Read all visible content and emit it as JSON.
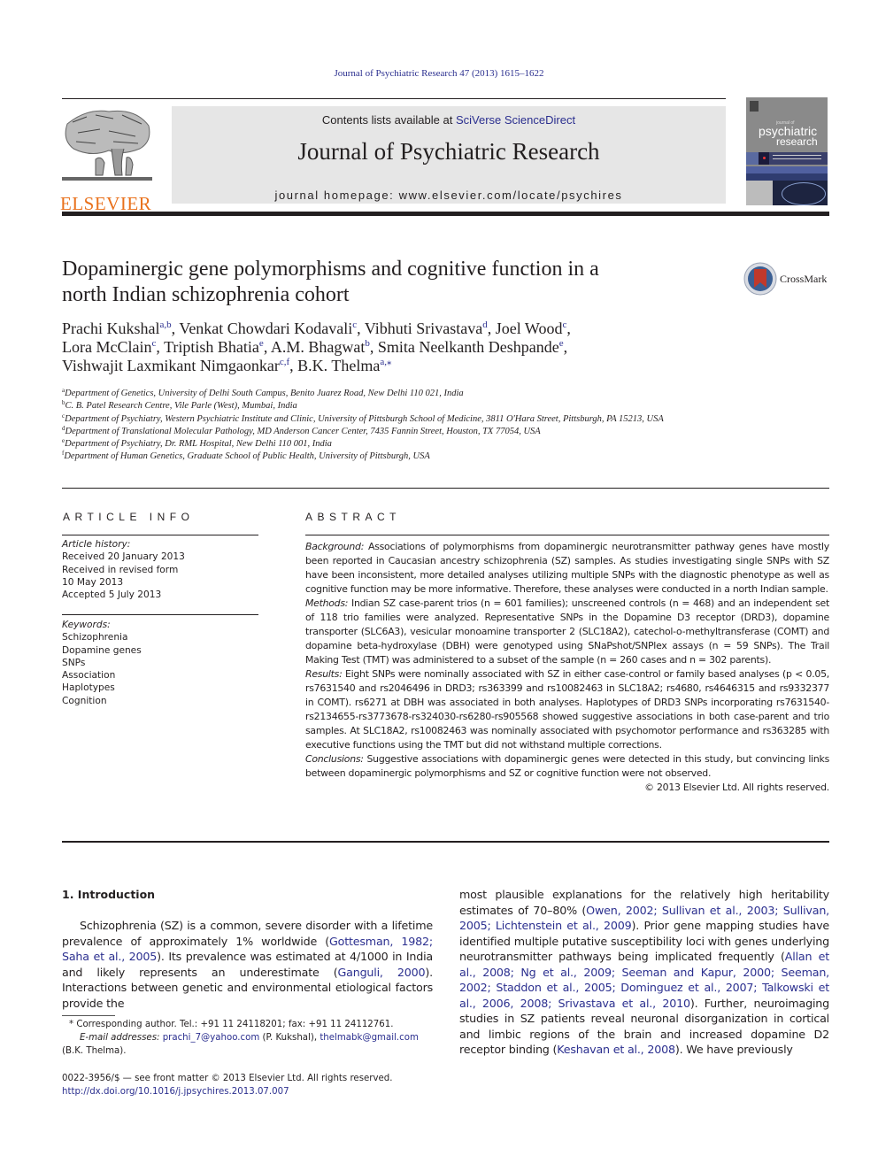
{
  "header": {
    "citation": "Journal of Psychiatric Research 47 (2013) 1615–1622",
    "contents_prefix": "Contents lists available at ",
    "contents_link": "SciVerse ScienceDirect",
    "journal_title": "Journal of Psychiatric Research",
    "homepage_prefix": "journal homepage: ",
    "homepage_url": "www.elsevier.com/locate/psychires",
    "publisher_logo_text": "ELSEVIER",
    "cover_small": "journal of",
    "cover_title_1": "psychiatric",
    "cover_title_2": "research",
    "crossmark_label": "CrossMark"
  },
  "colors": {
    "link": "#2b2f8f",
    "elsevier_orange": "#e9711c",
    "banner_gray": "#e6e6e6",
    "crossmark_red": "#c0392b"
  },
  "article": {
    "title_line1": "Dopaminergic gene polymorphisms and cognitive function in a",
    "title_line2": "north Indian schizophrenia cohort",
    "authors": [
      {
        "name": "Prachi Kukshal",
        "sup": "a,b",
        "sep": ", "
      },
      {
        "name": "Venkat Chowdari Kodavali",
        "sup": "c",
        "sep": ", "
      },
      {
        "name": "Vibhuti Srivastava",
        "sup": "d",
        "sep": ", "
      },
      {
        "name": "Joel Wood",
        "sup": "c",
        "sep": ","
      },
      {
        "name": "Lora McClain",
        "sup": "c",
        "sep": ", "
      },
      {
        "name": "Triptish Bhatia",
        "sup": "e",
        "sep": ", "
      },
      {
        "name": "A.M. Bhagwat",
        "sup": "b",
        "sep": ", "
      },
      {
        "name": "Smita Neelkanth Deshpande",
        "sup": "e",
        "sep": ","
      },
      {
        "name": "Vishwajit Laxmikant Nimgaonkar",
        "sup": "c,f",
        "sep": ", "
      },
      {
        "name": "B.K. Thelma",
        "sup": "a,⁎",
        "sep": ""
      }
    ],
    "affiliations": [
      {
        "key": "a",
        "text": "Department of Genetics, University of Delhi South Campus, Benito Juarez Road, New Delhi 110 021, India"
      },
      {
        "key": "b",
        "text": "C. B. Patel Research Centre, Vile Parle (West), Mumbai, India"
      },
      {
        "key": "c",
        "text": "Department of Psychiatry, Western Psychiatric Institute and Clinic, University of Pittsburgh School of Medicine, 3811 O'Hara Street, Pittsburgh, PA 15213, USA"
      },
      {
        "key": "d",
        "text": "Department of Translational Molecular Pathology, MD Anderson Cancer Center, 7435 Fannin Street, Houston, TX 77054, USA"
      },
      {
        "key": "e",
        "text": "Department of Psychiatry, Dr. RML Hospital, New Delhi 110 001, India"
      },
      {
        "key": "f",
        "text": "Department of Human Genetics, Graduate School of Public Health, University of Pittsburgh, USA"
      }
    ]
  },
  "article_info": {
    "heading": "ARTICLE INFO",
    "history_label": "Article history:",
    "history": [
      "Received 20 January 2013",
      "Received in revised form",
      "10 May 2013",
      "Accepted 5 July 2013"
    ],
    "keywords_label": "Keywords:",
    "keywords": [
      "Schizophrenia",
      "Dopamine genes",
      "SNPs",
      "Association",
      "Haplotypes",
      "Cognition"
    ]
  },
  "abstract": {
    "heading": "ABSTRACT",
    "background_label": "Background:",
    "background": " Associations of polymorphisms from dopaminergic neurotransmitter pathway genes have mostly been reported in Caucasian ancestry schizophrenia (SZ) samples. As studies investigating single SNPs with SZ have been inconsistent, more detailed analyses utilizing multiple SNPs with the diagnostic phenotype as well as cognitive function may be more informative. Therefore, these analyses were conducted in a north Indian sample.",
    "methods_label": "Methods:",
    "methods": " Indian SZ case-parent trios (n = 601 families); unscreened controls (n = 468) and an independent set of 118 trio families were analyzed. Representative SNPs in the Dopamine D3 receptor (DRD3), dopamine transporter (SLC6A3), vesicular monoamine transporter 2 (SLC18A2), catechol-o-methyltransferase (COMT) and dopamine beta-hydroxylase (DBH) were genotyped using SNaPshot/SNPlex assays (n = 59 SNPs). The Trail Making Test (TMT) was administered to a subset of the sample (n = 260 cases and n = 302 parents).",
    "results_label": "Results:",
    "results": " Eight SNPs were nominally associated with SZ in either case-control or family based analyses (p < 0.05, rs7631540 and rs2046496 in DRD3; rs363399 and rs10082463 in SLC18A2; rs4680, rs4646315 and rs9332377 in COMT). rs6271 at DBH was associated in both analyses. Haplotypes of DRD3 SNPs incorporating rs7631540-rs2134655-rs3773678-rs324030-rs6280-rs905568 showed suggestive associations in both case-parent and trio samples. At SLC18A2, rs10082463 was nominally associated with psychomotor performance and rs363285 with executive functions using the TMT but did not withstand multiple corrections.",
    "conclusions_label": "Conclusions:",
    "conclusions": " Suggestive associations with dopaminergic genes were detected in this study, but convincing links between dopaminergic polymorphisms and SZ or cognitive function were not observed.",
    "copyright": "© 2013 Elsevier Ltd. All rights reserved."
  },
  "introduction": {
    "heading": "1.  Introduction",
    "left": [
      {
        "t": "Schizophrenia (SZ) is a common, severe disorder with a lifetime prevalence of approximately 1% worldwide ("
      },
      {
        "t": "Gottesman, 1982; Saha et al., 2005",
        "link": true
      },
      {
        "t": "). Its prevalence was estimated at 4/1000 in India and likely represents an underestimate ("
      },
      {
        "t": "Ganguli, 2000",
        "link": true
      },
      {
        "t": "). Interactions between genetic and environmental etiological factors provide the"
      }
    ],
    "right": [
      {
        "t": "most plausible explanations for the relatively high heritability estimates of 70–80% ("
      },
      {
        "t": "Owen, 2002; Sullivan et al., 2003; Sullivan, 2005; Lichtenstein et al., 2009",
        "link": true
      },
      {
        "t": "). Prior gene mapping studies have identified multiple putative susceptibility loci with genes underlying neurotransmitter pathways being implicated frequently ("
      },
      {
        "t": "Allan et al., 2008; Ng et al., 2009; Seeman and Kapur, 2000; Seeman, 2002; Staddon et al., 2005; Dominguez et al., 2007; Talkowski et al., 2006, 2008; Srivastava et al., 2010",
        "link": true
      },
      {
        "t": "). Further, neuroimaging studies in SZ patients reveal neuronal disorganization in cortical and limbic regions of the brain and increased dopamine D2 receptor binding ("
      },
      {
        "t": "Keshavan et al., 2008",
        "link": true
      },
      {
        "t": "). We have previously"
      }
    ]
  },
  "footnotes": {
    "corresponding": "* Corresponding author. Tel.: +91 11 24118201; fax: +91 11 24112761.",
    "email_label": "E-mail addresses:",
    "email1": "prachi_7@yahoo.com",
    "email1_owner": " (P. Kukshal), ",
    "email2": "thelmabk@gmail.com",
    "email2_owner": "(B.K. Thelma).",
    "issn": "0022-3956/$ — see front matter © 2013 Elsevier Ltd. All rights reserved.",
    "doi": "http://dx.doi.org/10.1016/j.jpsychires.2013.07.007"
  }
}
